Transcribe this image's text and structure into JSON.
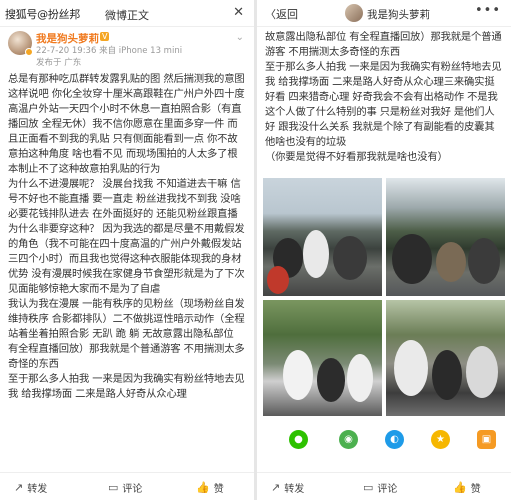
{
  "left": {
    "watermark": "搜狐号@扮丝邦",
    "title": "微博正文",
    "close_icon": "✕",
    "post": {
      "username": "我是狗头萝莉",
      "badge": "V",
      "meta": "22-7-20 19:36 来自 iPhone 13 mini",
      "location": "发布于 广东",
      "text": "总是有那种吃瓜群转发露乳贴的图 然后揣测我的意图 这样说吧 你化全妆穿十厘米高跟鞋在广州户外四十度高温户外站一天四个小时不休息一直拍照合影（有直播回放 全程无休）我不信你愿意在里面多穿一件 而且正面看不到我的乳贴 只有侧面能看到一点 你不故意拍这种角度 啥也看不见 而现场围拍的人太多了根本制止不了这种故意拍乳贴的行为\n为什么不进漫展呢？ 没展台找我 不知道进去干嘛 信号不好也不能直播 要一直走 粉丝进我找不到我 没啥必要花钱排队进去 在外面挺好的 还能见粉丝跟直播\n为什么非要穿这种？ 因为我选的都是尽量不用戴假发的角色（我不可能在四十度高温的广州户外戴假发站三四个小时）而且我也觉得这种衣服能体现我的身材优势 没有漫展时候我在家健身节食塑形就是为了下次见面能够惊艳大家而不是为了自虐\n我认为我在漫展 一能有秩序的见粉丝（现场粉丝自发维持秩序 合影都排队）二不做挑逗性暗示动作（全程站着坐着拍照合影 无趴 跪 躺 无故意露出隐私部位 有全程直播回放）那我就是个普通游客 不用揣测太多奇怪的东西\n至于那么多人拍我 一来是因为我确实有粉丝特地去见我 给我撑场面 二来是路人好奇从众心理"
    },
    "actions": {
      "share": "转发",
      "comment": "评论",
      "like": "赞"
    }
  },
  "right": {
    "back": "返回",
    "name": "我是狗头萝莉",
    "more_icon": "•••",
    "text": "故意露出隐私部位 有全程直播回放）那我就是个普通游客 不用揣测太多奇怪的东西\n至于那么多人拍我 一来是因为我确实有粉丝特地去见我 给我撑场面 二来是路人好奇从众心理三来确实挺好看 四来猎奇心理 好奇我会不会有出格动作 不是我这个人做了什么特别的事 只是粉丝对我好 是他们人好 跟我没什么关系 我就是个除了有副能看的皮囊其他啥也没有的垃圾\n（你要是觉得不好看那我就是啥也没有）",
    "share_icons": [
      "wechat-icon",
      "moments-icon",
      "qq-icon",
      "qzone-icon",
      "more-share-icon"
    ],
    "actions": {
      "share": "转发",
      "comment": "评论",
      "like": "赞"
    }
  },
  "colors": {
    "username": "#f07a1f",
    "wechat": "#2dc100",
    "moments": "#4cb04f",
    "qq": "#1e9be8",
    "qzone": "#f6b700",
    "more": "#f59a23"
  }
}
